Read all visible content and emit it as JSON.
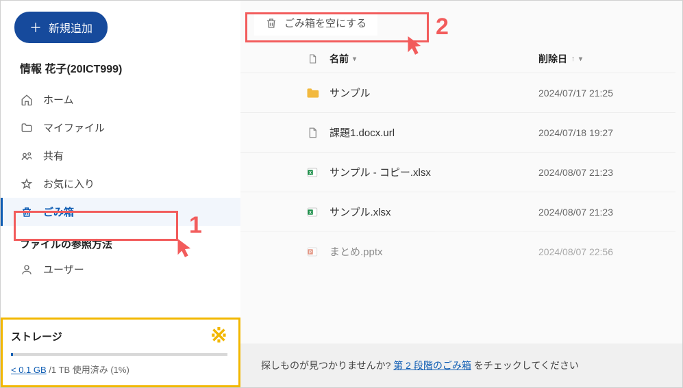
{
  "sidebar": {
    "add_label": "新規追加",
    "user_name": "情報 花子(20ICT999)",
    "items": [
      {
        "icon": "home-icon",
        "label": "ホーム"
      },
      {
        "icon": "folder-icon",
        "label": "マイファイル"
      },
      {
        "icon": "share-icon",
        "label": "共有"
      },
      {
        "icon": "star-icon",
        "label": "お気に入り"
      },
      {
        "icon": "trash-icon",
        "label": "ごみ箱",
        "selected": true
      }
    ],
    "section_label": "ファイルの参照方法",
    "secondary": [
      {
        "icon": "user-icon",
        "label": "ユーザー"
      }
    ],
    "storage": {
      "title": "ストレージ",
      "usage_link": "< 0.1 GB",
      "usage_rest": " /1 TB 使用済み (1%)",
      "note_symbol": "※"
    }
  },
  "toolbar": {
    "empty_label": "ごみ箱を空にする"
  },
  "columns": {
    "name": "名前",
    "date": "削除日"
  },
  "rows": [
    {
      "type": "folder",
      "name": "サンプル",
      "date": "2024/07/17 21:25"
    },
    {
      "type": "file",
      "name": "課題1.docx.url",
      "date": "2024/07/18 19:27"
    },
    {
      "type": "xlsx",
      "name": "サンプル - コピー.xlsx",
      "date": "2024/08/07 21:23"
    },
    {
      "type": "xlsx",
      "name": "サンプル.xlsx",
      "date": "2024/08/07 21:23"
    },
    {
      "type": "pptx",
      "name": "まとめ.pptx",
      "date": "2024/08/07 22:56"
    }
  ],
  "footer": {
    "prefix": "探しものが見つかりませんか? ",
    "link": "第 2 段階のごみ箱",
    "suffix": " をチェックしてください"
  },
  "annotations": {
    "label1": "1",
    "label2": "2"
  }
}
